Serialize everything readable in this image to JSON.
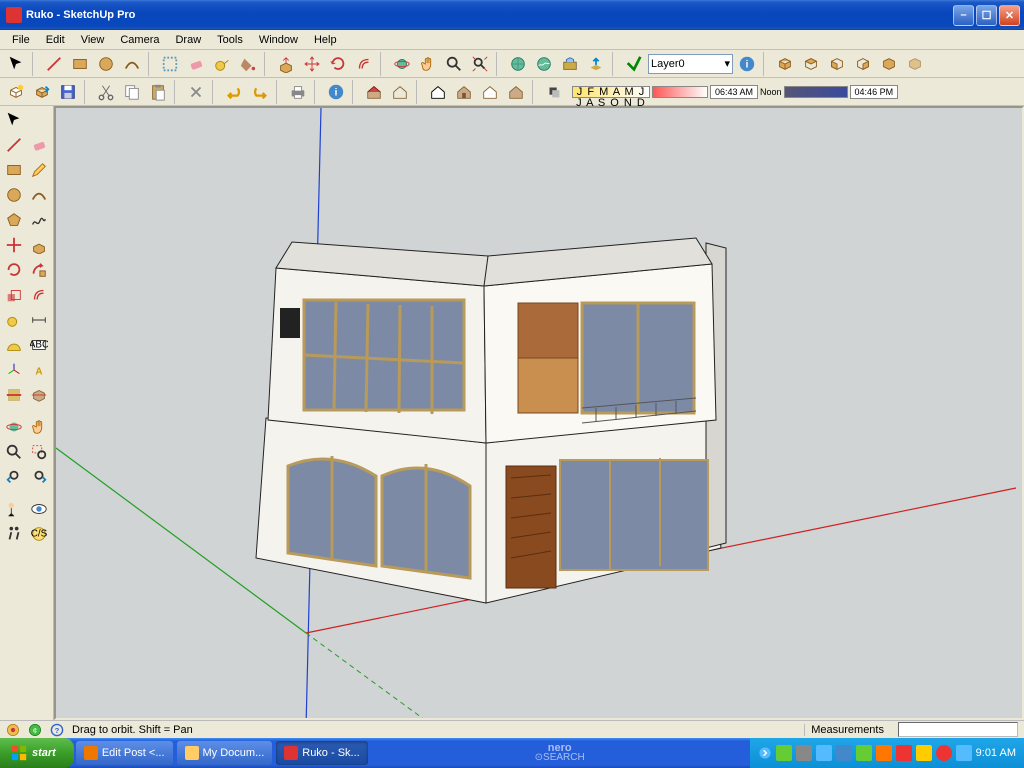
{
  "title": "Ruko - SketchUp Pro",
  "menu": [
    "File",
    "Edit",
    "View",
    "Camera",
    "Draw",
    "Tools",
    "Window",
    "Help"
  ],
  "layer": "Layer0",
  "months": "J F M A M J J A S O N D",
  "time1": "06:43 AM",
  "noon": "Noon",
  "time2": "04:46 PM",
  "status_hint": "Drag to orbit.  Shift = Pan",
  "measurements_label": "Measurements",
  "start": "start",
  "tasks": [
    {
      "label": "Edit Post <..."
    },
    {
      "label": "My Docum..."
    },
    {
      "label": "Ruko - Sk..."
    }
  ],
  "clock": "9:01 AM",
  "nero": "nero",
  "view_style_icons": [
    "wireframe",
    "hidden-line",
    "shaded",
    "shaded-textures",
    "monochrome",
    "xray"
  ]
}
